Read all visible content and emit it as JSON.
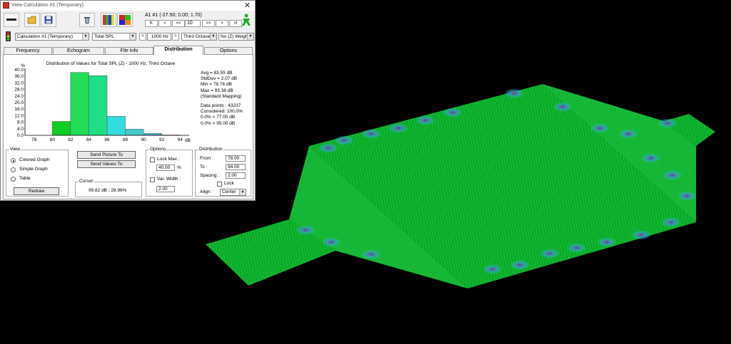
{
  "window": {
    "title": "View Calculation #1 (Temporary)",
    "close_glyph": "✕"
  },
  "toolbar": {
    "coordinate_readout": "A1 #1  (-27.50; 0.00; 1.70)",
    "nav_buttons": [
      "K",
      "<",
      "<<",
      ">>",
      ">",
      ">I"
    ],
    "step_value": "10"
  },
  "selectors": {
    "calculation": "Calculation #1 (Temporary)",
    "parameter": "Total SPL",
    "frequency": "1000 Hz",
    "band": "Third Octave",
    "weighting": "No (Z) Weigh"
  },
  "tabs": [
    "Frequency",
    "Echogram",
    "File Info",
    "Distribution",
    "Options"
  ],
  "active_tab": "Distribution",
  "chart_data": {
    "type": "bar",
    "title": "Distribution of Values for Total SPL (Z) - 1000 Hz, Third Octave",
    "ylabel": "%",
    "xlabel": "dB",
    "ylim": [
      0,
      40
    ],
    "yticks": [
      "40.0",
      "36.0",
      "32.0",
      "28.0",
      "24.0",
      "20.0",
      "16.0",
      "12.0",
      "8.0",
      "4.0",
      "0.0"
    ],
    "xticks": [
      "78",
      "80",
      "82",
      "84",
      "86",
      "88",
      "90",
      "92",
      "94"
    ],
    "bins": [
      {
        "from": 78,
        "to": 80,
        "value": 0.0,
        "color": "#00cc33"
      },
      {
        "from": 80,
        "to": 82,
        "value": 8.5,
        "color": "#11cc22"
      },
      {
        "from": 82,
        "to": 84,
        "value": 38.4,
        "color": "#22dd55"
      },
      {
        "from": 84,
        "to": 86,
        "value": 36.4,
        "color": "#22dd88"
      },
      {
        "from": 86,
        "to": 88,
        "value": 11.6,
        "color": "#33dddd"
      },
      {
        "from": 88,
        "to": 90,
        "value": 3.8,
        "color": "#44cccc"
      },
      {
        "from": 90,
        "to": 92,
        "value": 1.1,
        "color": "#44aacc"
      },
      {
        "from": 92,
        "to": 94,
        "value": 0.2,
        "color": "#cc3333"
      }
    ]
  },
  "stats": [
    "Avg = 83.55 dB",
    "StdDev = 2.07 dB",
    "Min = 78.76 dB",
    "Max = 93.38 dB",
    "(Standard Mapping)",
    "Data points : 43237",
    "Considered: 100.0%",
    "0.0% < 77.00 dB",
    "0.0% > 95.00 dB"
  ],
  "view": {
    "label": "View",
    "options": [
      "Colored Graph",
      "Simple Graph",
      "Table"
    ],
    "selected": "Colored Graph",
    "redraw": "Redraw"
  },
  "actions": {
    "send_picture": "Send Picture To",
    "send_values": "Send Values To"
  },
  "cursor": {
    "label": "Cursor",
    "value": "99.82 dB ; 28.96%"
  },
  "options": {
    "label": "Options",
    "lock_max_label": "Lock Max :",
    "lock_max_value": "40.00",
    "lock_max_unit": "%",
    "var_width_label": "Var. Width :",
    "var_width_value": "2.00"
  },
  "distribution": {
    "label": "Distribution",
    "from_label": "From :",
    "from_value": "78.00",
    "to_label": "To :",
    "to_value": "94.00",
    "spacing_label": "Spacing :",
    "spacing_value": "2.00",
    "lock_label": "Lock",
    "align_label": "Align :",
    "align_value": "Center"
  },
  "viewport": {
    "background": "#000000",
    "mesh_color": "#00c832",
    "hotspot_color": "#3cc8dc"
  }
}
